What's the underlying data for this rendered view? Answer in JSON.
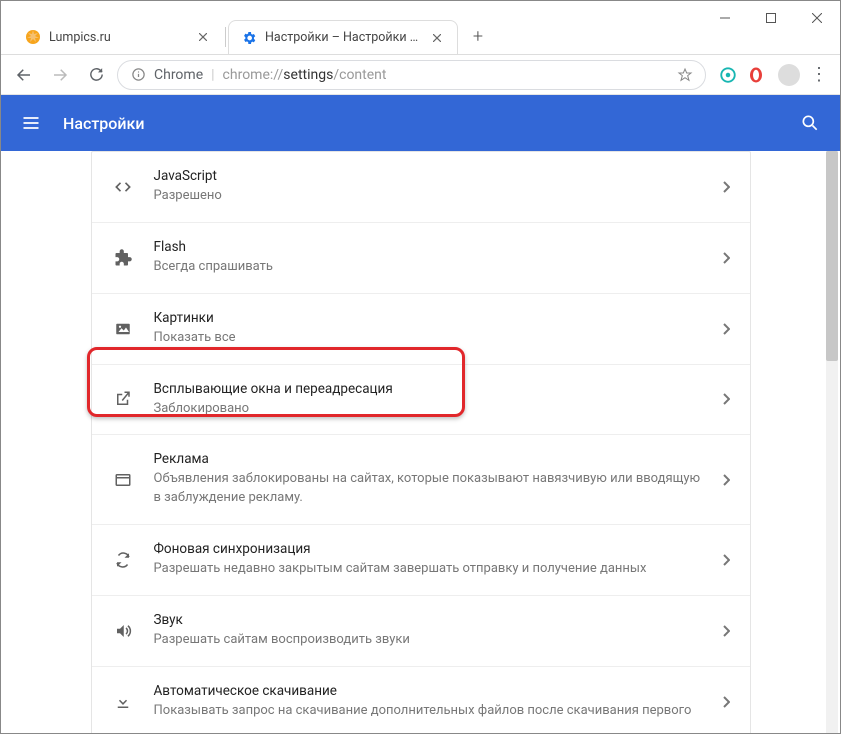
{
  "window": {
    "tabs": [
      {
        "title": "Lumpics.ru",
        "active": false
      },
      {
        "title": "Настройки – Настройки сайта",
        "active": true
      }
    ]
  },
  "omnibox": {
    "chrome_label": "Chrome",
    "url_gray_prefix": "chrome://",
    "url_dark": "settings",
    "url_gray_suffix": "/content"
  },
  "settings_header": {
    "title": "Настройки"
  },
  "rows": [
    {
      "key": "javascript",
      "icon": "code",
      "title": "JavaScript",
      "sub": "Разрешено"
    },
    {
      "key": "flash",
      "icon": "puzzle",
      "title": "Flash",
      "sub": "Всегда спрашивать"
    },
    {
      "key": "images",
      "icon": "image",
      "title": "Картинки",
      "sub": "Показать все"
    },
    {
      "key": "popups",
      "icon": "open-in-new",
      "title": "Всплывающие окна и переадресация",
      "sub": "Заблокировано",
      "highlighted": true
    },
    {
      "key": "ads",
      "icon": "window",
      "title": "Реклама",
      "sub": "Объявления заблокированы на сайтах, которые показывают навязчивую или вводящую в заблуждение рекламу."
    },
    {
      "key": "bg-sync",
      "icon": "sync",
      "title": "Фоновая синхронизация",
      "sub": "Разрешать недавно закрытым сайтам завершать отправку и получение данных"
    },
    {
      "key": "sound",
      "icon": "sound",
      "title": "Звук",
      "sub": "Разрешать сайтам воспроизводить звуки"
    },
    {
      "key": "auto-download",
      "icon": "download",
      "title": "Автоматическое скачивание",
      "sub": "Показывать запрос на скачивание дополнительных файлов после скачивания первого"
    }
  ]
}
